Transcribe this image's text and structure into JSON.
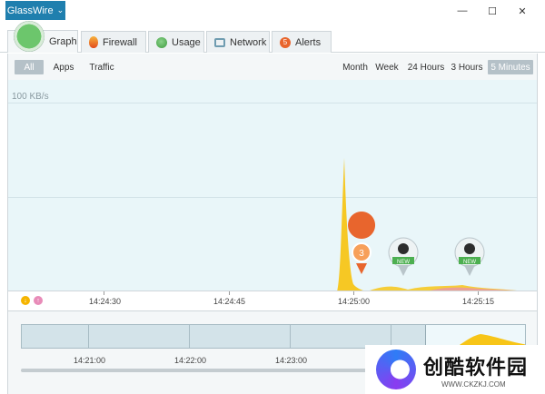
{
  "app": {
    "menu_label": "GlassWire"
  },
  "window": {
    "minimize": "—",
    "maximize": "☐",
    "close": "✕"
  },
  "tabs": [
    {
      "label": "Graph",
      "icon": "graph-icon",
      "active": true
    },
    {
      "label": "Firewall",
      "icon": "fire-icon"
    },
    {
      "label": "Usage",
      "icon": "usage-icon"
    },
    {
      "label": "Network",
      "icon": "network-icon"
    },
    {
      "label": "Alerts",
      "icon": "alert-icon",
      "badge": "5"
    }
  ],
  "filters": {
    "left": [
      "All",
      "Apps",
      "Traffic"
    ],
    "selected_left": "All",
    "right": [
      "Month",
      "Week",
      "24 Hours",
      "3 Hours",
      "5 Minutes"
    ],
    "selected_right": "5 Minutes"
  },
  "graph": {
    "y_label": "100 KB/s",
    "time_labels": [
      "14:24:30",
      "14:24:45",
      "14:25:00",
      "14:25:15"
    ],
    "markers": [
      {
        "type": "count",
        "label": "3",
        "color": "#e8652d"
      },
      {
        "type": "new",
        "label": "NEW",
        "color": "#4caf50"
      },
      {
        "type": "new",
        "label": "NEW",
        "color": "#4caf50"
      }
    ],
    "legend": {
      "incoming": "↓",
      "outgoing": "↑"
    }
  },
  "overview": {
    "time_labels": [
      "14:21:00",
      "14:22:00",
      "14:23:00"
    ]
  },
  "watermark": {
    "title": "创酷软件园",
    "url": "WWW.CKZKJ.COM"
  },
  "colors": {
    "accent": "#1f7fae",
    "incoming": "#f5b400",
    "outgoing": "#e88bb8"
  }
}
